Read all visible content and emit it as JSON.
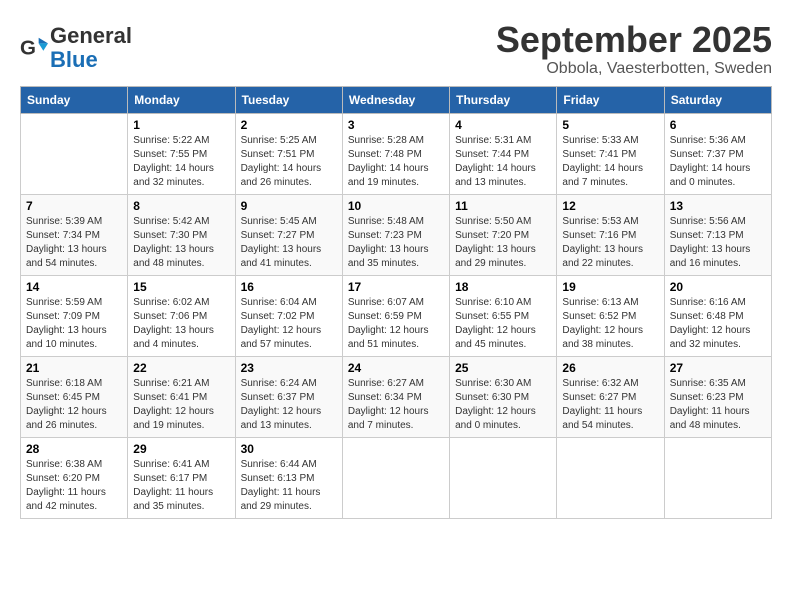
{
  "header": {
    "logo_general": "General",
    "logo_blue": "Blue",
    "month_title": "September 2025",
    "location": "Obbola, Vaesterbotten, Sweden"
  },
  "days_of_week": [
    "Sunday",
    "Monday",
    "Tuesday",
    "Wednesday",
    "Thursday",
    "Friday",
    "Saturday"
  ],
  "weeks": [
    [
      {
        "day": "",
        "info": ""
      },
      {
        "day": "1",
        "info": "Sunrise: 5:22 AM\nSunset: 7:55 PM\nDaylight: 14 hours\nand 32 minutes."
      },
      {
        "day": "2",
        "info": "Sunrise: 5:25 AM\nSunset: 7:51 PM\nDaylight: 14 hours\nand 26 minutes."
      },
      {
        "day": "3",
        "info": "Sunrise: 5:28 AM\nSunset: 7:48 PM\nDaylight: 14 hours\nand 19 minutes."
      },
      {
        "day": "4",
        "info": "Sunrise: 5:31 AM\nSunset: 7:44 PM\nDaylight: 14 hours\nand 13 minutes."
      },
      {
        "day": "5",
        "info": "Sunrise: 5:33 AM\nSunset: 7:41 PM\nDaylight: 14 hours\nand 7 minutes."
      },
      {
        "day": "6",
        "info": "Sunrise: 5:36 AM\nSunset: 7:37 PM\nDaylight: 14 hours\nand 0 minutes."
      }
    ],
    [
      {
        "day": "7",
        "info": "Sunrise: 5:39 AM\nSunset: 7:34 PM\nDaylight: 13 hours\nand 54 minutes."
      },
      {
        "day": "8",
        "info": "Sunrise: 5:42 AM\nSunset: 7:30 PM\nDaylight: 13 hours\nand 48 minutes."
      },
      {
        "day": "9",
        "info": "Sunrise: 5:45 AM\nSunset: 7:27 PM\nDaylight: 13 hours\nand 41 minutes."
      },
      {
        "day": "10",
        "info": "Sunrise: 5:48 AM\nSunset: 7:23 PM\nDaylight: 13 hours\nand 35 minutes."
      },
      {
        "day": "11",
        "info": "Sunrise: 5:50 AM\nSunset: 7:20 PM\nDaylight: 13 hours\nand 29 minutes."
      },
      {
        "day": "12",
        "info": "Sunrise: 5:53 AM\nSunset: 7:16 PM\nDaylight: 13 hours\nand 22 minutes."
      },
      {
        "day": "13",
        "info": "Sunrise: 5:56 AM\nSunset: 7:13 PM\nDaylight: 13 hours\nand 16 minutes."
      }
    ],
    [
      {
        "day": "14",
        "info": "Sunrise: 5:59 AM\nSunset: 7:09 PM\nDaylight: 13 hours\nand 10 minutes."
      },
      {
        "day": "15",
        "info": "Sunrise: 6:02 AM\nSunset: 7:06 PM\nDaylight: 13 hours\nand 4 minutes."
      },
      {
        "day": "16",
        "info": "Sunrise: 6:04 AM\nSunset: 7:02 PM\nDaylight: 12 hours\nand 57 minutes."
      },
      {
        "day": "17",
        "info": "Sunrise: 6:07 AM\nSunset: 6:59 PM\nDaylight: 12 hours\nand 51 minutes."
      },
      {
        "day": "18",
        "info": "Sunrise: 6:10 AM\nSunset: 6:55 PM\nDaylight: 12 hours\nand 45 minutes."
      },
      {
        "day": "19",
        "info": "Sunrise: 6:13 AM\nSunset: 6:52 PM\nDaylight: 12 hours\nand 38 minutes."
      },
      {
        "day": "20",
        "info": "Sunrise: 6:16 AM\nSunset: 6:48 PM\nDaylight: 12 hours\nand 32 minutes."
      }
    ],
    [
      {
        "day": "21",
        "info": "Sunrise: 6:18 AM\nSunset: 6:45 PM\nDaylight: 12 hours\nand 26 minutes."
      },
      {
        "day": "22",
        "info": "Sunrise: 6:21 AM\nSunset: 6:41 PM\nDaylight: 12 hours\nand 19 minutes."
      },
      {
        "day": "23",
        "info": "Sunrise: 6:24 AM\nSunset: 6:37 PM\nDaylight: 12 hours\nand 13 minutes."
      },
      {
        "day": "24",
        "info": "Sunrise: 6:27 AM\nSunset: 6:34 PM\nDaylight: 12 hours\nand 7 minutes."
      },
      {
        "day": "25",
        "info": "Sunrise: 6:30 AM\nSunset: 6:30 PM\nDaylight: 12 hours\nand 0 minutes."
      },
      {
        "day": "26",
        "info": "Sunrise: 6:32 AM\nSunset: 6:27 PM\nDaylight: 11 hours\nand 54 minutes."
      },
      {
        "day": "27",
        "info": "Sunrise: 6:35 AM\nSunset: 6:23 PM\nDaylight: 11 hours\nand 48 minutes."
      }
    ],
    [
      {
        "day": "28",
        "info": "Sunrise: 6:38 AM\nSunset: 6:20 PM\nDaylight: 11 hours\nand 42 minutes."
      },
      {
        "day": "29",
        "info": "Sunrise: 6:41 AM\nSunset: 6:17 PM\nDaylight: 11 hours\nand 35 minutes."
      },
      {
        "day": "30",
        "info": "Sunrise: 6:44 AM\nSunset: 6:13 PM\nDaylight: 11 hours\nand 29 minutes."
      },
      {
        "day": "",
        "info": ""
      },
      {
        "day": "",
        "info": ""
      },
      {
        "day": "",
        "info": ""
      },
      {
        "day": "",
        "info": ""
      }
    ]
  ]
}
